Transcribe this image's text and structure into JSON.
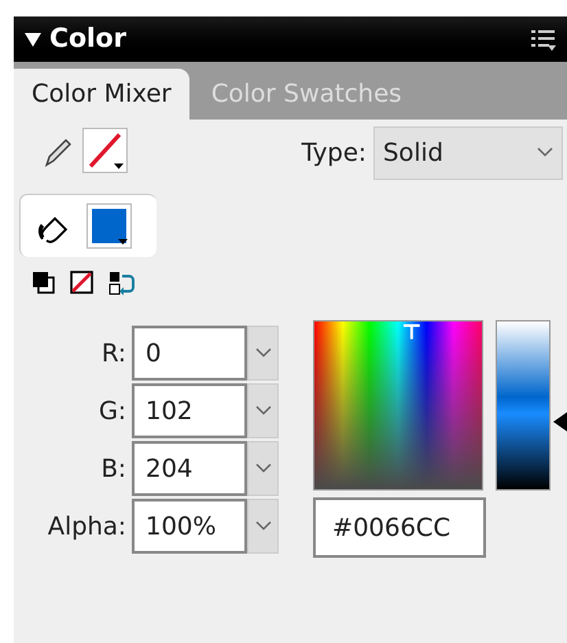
{
  "panel": {
    "title": "Color"
  },
  "tabs": [
    {
      "label": "Color Mixer",
      "selected": true
    },
    {
      "label": "Color Swatches",
      "selected": false
    }
  ],
  "stroke": {
    "kind": "none"
  },
  "type_select": {
    "label": "Type:",
    "value": "Solid"
  },
  "fill": {
    "color": "#0066cc"
  },
  "channels": [
    {
      "label": "R:",
      "value": "0"
    },
    {
      "label": "G:",
      "value": "102"
    },
    {
      "label": "B:",
      "value": "204"
    },
    {
      "label": "Alpha:",
      "value": "100%"
    }
  ],
  "hex": {
    "value": "#0066CC"
  },
  "brightness": {
    "level": 0.41
  }
}
